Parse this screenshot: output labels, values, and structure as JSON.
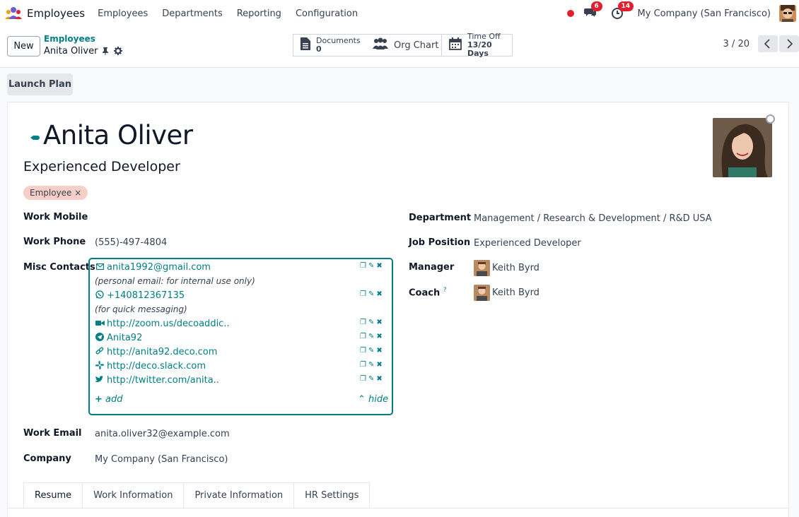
{
  "navbar": {
    "app_name": "Employees",
    "menu": [
      "Employees",
      "Departments",
      "Reporting",
      "Configuration"
    ],
    "messages_count": "6",
    "activities_count": "14",
    "company": "My Company (San Francisco)"
  },
  "control_panel": {
    "new_label": "New",
    "breadcrumb_parent": "Employees",
    "breadcrumb_current": "Anita Oliver",
    "documents_label": "Documents",
    "documents_count": "0",
    "org_chart_label": "Org Chart",
    "time_off_label": "Time Off",
    "time_off_value": "13/20 Days",
    "pager": "3 / 20"
  },
  "actions": {
    "launch_plan": "Launch Plan"
  },
  "employee": {
    "name": "Anita Oliver",
    "job_title": "Experienced Developer",
    "tag": "Employee"
  },
  "fields": {
    "work_mobile_label": "Work Mobile",
    "work_phone_label": "Work Phone",
    "work_phone": "(555)-497-4804",
    "misc_contacts_label": "Misc Contacts",
    "work_email_label": "Work Email",
    "work_email": "anita.oliver32@example.com",
    "company_label": "Company",
    "company": "My Company (San Francisco)",
    "department_label": "Department",
    "department": "Management / Research & Development / R&D USA",
    "job_position_label": "Job Position",
    "job_position": "Experienced Developer",
    "manager_label": "Manager",
    "manager": "Keith Byrd",
    "coach_label": "Coach",
    "coach_help": "?",
    "coach": "Keith Byrd"
  },
  "misc_contacts": {
    "items": [
      {
        "icon": "envelope-icon",
        "value": "anita1992@gmail.com",
        "note": "(personal email: for internal use only)"
      },
      {
        "icon": "whatsapp-icon",
        "value": "+140812367135",
        "note": "(for quick messaging)"
      },
      {
        "icon": "video-icon",
        "value": "http://zoom.us/decoaddic.."
      },
      {
        "icon": "telegram-icon",
        "value": "Anita92"
      },
      {
        "icon": "link-icon",
        "value": "http://anita92.deco.com"
      },
      {
        "icon": "slack-icon",
        "value": "http://deco.slack.com"
      },
      {
        "icon": "twitter-icon",
        "value": "http://twitter.com/anita.."
      }
    ],
    "add_label": "add",
    "hide_label": "hide"
  },
  "tabs": [
    "Resume",
    "Work Information",
    "Private Information",
    "HR Settings"
  ],
  "colors": {
    "accent": "#017e84",
    "badge": "#e0202e",
    "tag_bg": "#f6d0c8"
  }
}
